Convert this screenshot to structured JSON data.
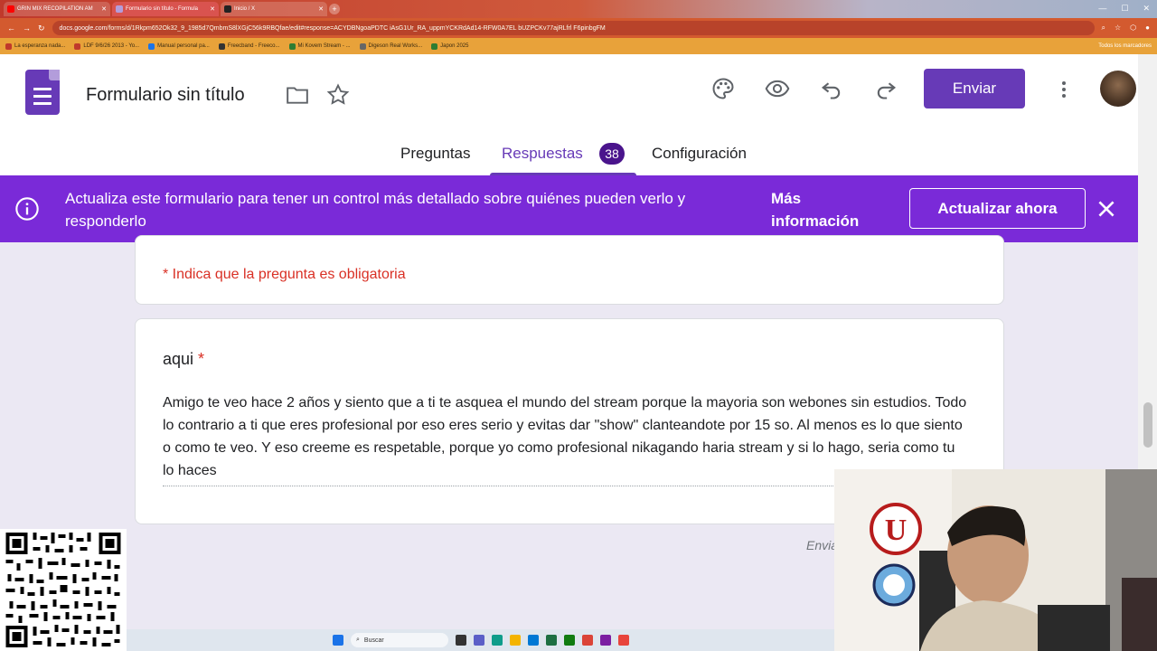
{
  "browser": {
    "tabs": [
      {
        "label": "GRIN MIX RECOPILATION AM"
      },
      {
        "label": "Formulario sin título - Formula"
      },
      {
        "label": "Inicio / X"
      }
    ],
    "url_host": "docs.google.com",
    "url_path": "/forms/d/1Rkpm652Ok32_9_1985d7QmbmS8lXGjC56k9RBQfae/edit#response=ACYDBNgoaPDTC iAsG1Ur_RA_uppmYCKRdAd14-RFW0A7EL bUZPCKv77ajRLfrl F6pinbgFM",
    "bookmarks": [
      "La esperanza nada...",
      "LDF 9/6/26 2013 - Yo...",
      "Manual personal pa...",
      "Freecband - Freeco...",
      "Mi Kovem Stream - ...",
      "Digeson Real Works...",
      "Japon 2025"
    ],
    "bookmarks_right": "Todos los marcadores"
  },
  "forms": {
    "doc_title": "Formulario sin título",
    "send_label": "Enviar",
    "tabs": {
      "questions": "Preguntas",
      "responses": "Respuestas",
      "responses_count": "38",
      "settings": "Configuración"
    },
    "accent_color": "#673ab7"
  },
  "banner": {
    "message": "Actualiza este formulario para tener un control más detallado sobre quiénes pueden verlo y responderlo",
    "more_info": "Más información",
    "update_button": "Actualizar ahora"
  },
  "form": {
    "required_note": "* Indica que la pregunta es obligatoria",
    "question_title": "aqui",
    "required_mark": "*",
    "answer": "Amigo te veo hace 2 años y siento que a ti te asquea el mundo del stream porque la mayoria son webones sin estudios. Todo lo contrario a ti que eres profesional por eso eres serio y evitas dar \"show\" clanteandote por 15 so. Al menos es lo que siento o como te veo. Y eso creeme es respetable, porque yo como profesional nikagando haria stream y si lo hago, seria como tu lo haces",
    "send_partial": "Envia"
  },
  "taskbar": {
    "search_label": "Buscar"
  }
}
